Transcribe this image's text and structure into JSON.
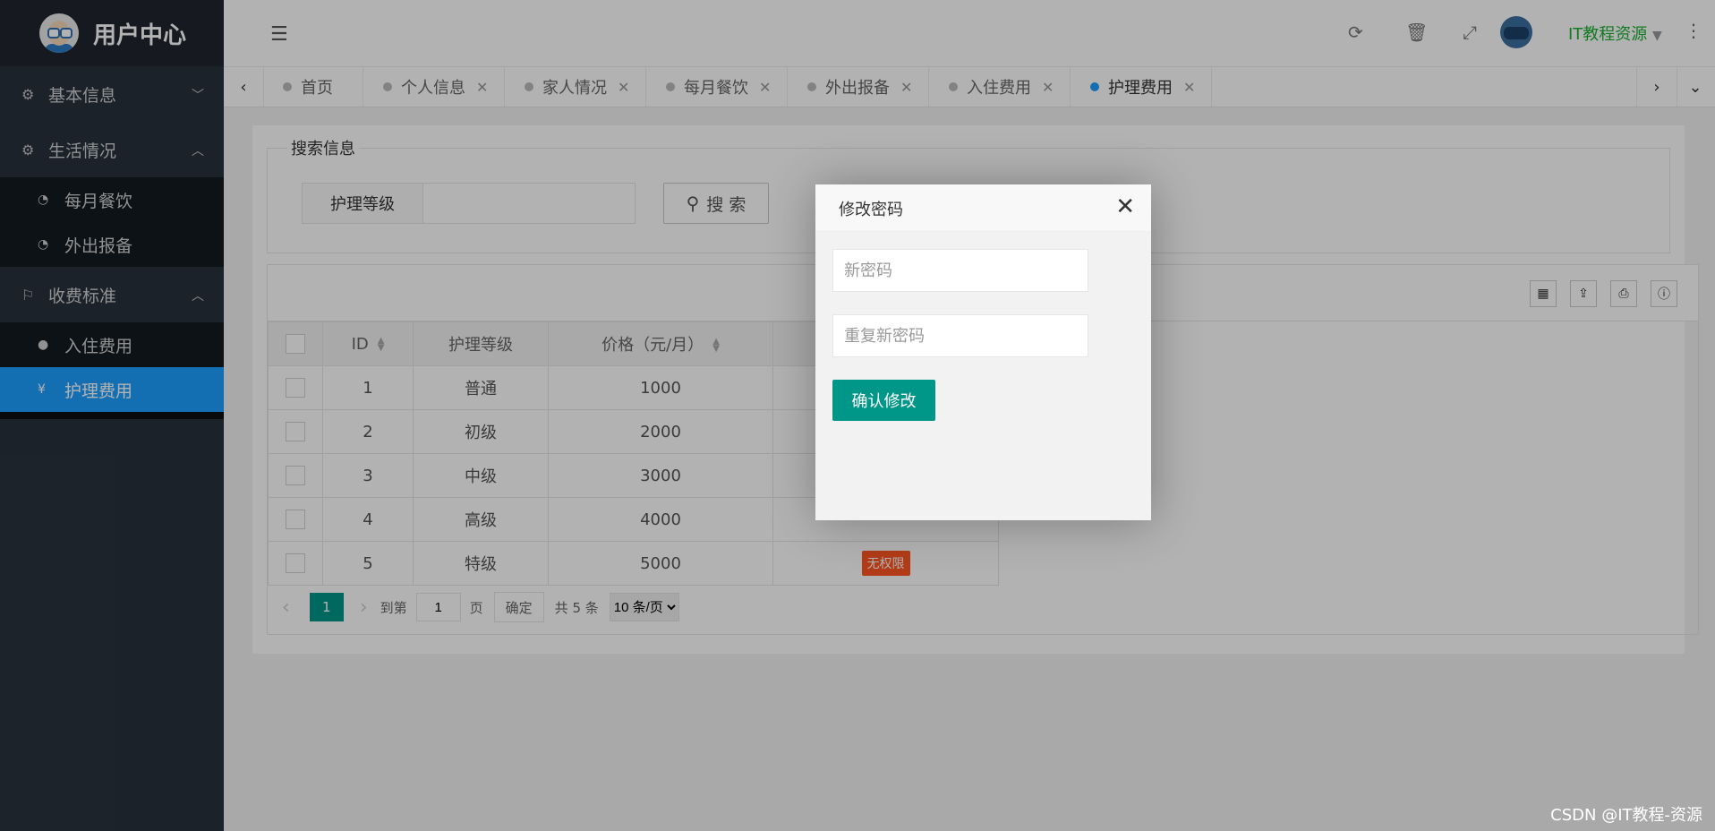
{
  "app": {
    "title": "用户中心"
  },
  "sidebar": {
    "groups": [
      {
        "label": "基本信息",
        "icon": "gears-icon",
        "expanded": false,
        "items": []
      },
      {
        "label": "生活情况",
        "icon": "gears-icon",
        "expanded": true,
        "items": [
          {
            "label": "每月餐饮",
            "icon": "dashboard-icon"
          },
          {
            "label": "外出报备",
            "icon": "dashboard-icon"
          }
        ]
      },
      {
        "label": "收费标准",
        "icon": "flag-icon",
        "expanded": true,
        "items": [
          {
            "label": "入住费用",
            "icon": "coin-icon"
          },
          {
            "label": "护理费用",
            "icon": "yen-icon",
            "active": true
          }
        ]
      }
    ]
  },
  "topbar": {
    "user": "IT教程资源"
  },
  "tabs": [
    {
      "label": "首页",
      "closable": false
    },
    {
      "label": "个人信息",
      "closable": true
    },
    {
      "label": "家人情况",
      "closable": true
    },
    {
      "label": "每月餐饮",
      "closable": true
    },
    {
      "label": "外出报备",
      "closable": true
    },
    {
      "label": "入住费用",
      "closable": true
    },
    {
      "label": "护理费用",
      "closable": true,
      "active": true
    }
  ],
  "search": {
    "legend": "搜索信息",
    "label": "护理等级",
    "value": "",
    "button": "搜 索"
  },
  "table": {
    "headers": [
      "ID",
      "护理等级",
      "价格（元/月）"
    ],
    "rows": [
      {
        "id": "1",
        "level": "普通",
        "price": "1000",
        "badge": ""
      },
      {
        "id": "2",
        "level": "初级",
        "price": "2000",
        "badge": ""
      },
      {
        "id": "3",
        "level": "中级",
        "price": "3000",
        "badge": ""
      },
      {
        "id": "4",
        "level": "高级",
        "price": "4000",
        "badge": ""
      },
      {
        "id": "5",
        "level": "特级",
        "price": "5000",
        "badge": "无权限"
      }
    ]
  },
  "pager": {
    "current": "1",
    "goto_label": "到第",
    "goto_value": "1",
    "page_unit": "页",
    "confirm": "确定",
    "total": "共 5 条",
    "per_page": "10 条/页"
  },
  "modal": {
    "title": "修改密码",
    "new_password_placeholder": "新密码",
    "repeat_password_placeholder": "重复新密码",
    "submit": "确认修改"
  },
  "watermark": "CSDN @IT教程-资源",
  "colors": {
    "accent": "#1e9fff",
    "primary_btn": "#009688",
    "danger": "#ff5722",
    "user_name": "#1aaf2f",
    "sidebar_bg": "#28323d"
  }
}
